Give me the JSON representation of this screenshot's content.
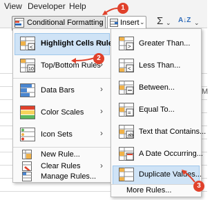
{
  "ribbon": {
    "tabs": [
      "View",
      "Developer",
      "Help"
    ],
    "conditional_formatting_label": "Conditional Formatting",
    "insert_label": "Insert",
    "sum_symbol": "Σ",
    "sort_symbol": "A↓Z"
  },
  "sheet": {
    "col_label": "M"
  },
  "menu": {
    "items": [
      {
        "label": "Highlight Cells Rules",
        "hotkey_index": 0
      },
      {
        "label": "Top/Bottom Rules"
      },
      {
        "label": "Data Bars"
      },
      {
        "label": "Color Scales"
      },
      {
        "label": "Icon Sets"
      },
      {
        "label": "New Rule..."
      },
      {
        "label": "Clear Rules"
      },
      {
        "label": "Manage Rules..."
      }
    ]
  },
  "submenu": {
    "items": [
      {
        "label": "Greater Than..."
      },
      {
        "label": "Less Than..."
      },
      {
        "label": "Between..."
      },
      {
        "label": "Equal To..."
      },
      {
        "label": "Text that Contains..."
      },
      {
        "label": "A Date Occurring..."
      },
      {
        "label": "Duplicate Values..."
      },
      {
        "label": "More Rules..."
      }
    ]
  },
  "badges": [
    "1",
    "2",
    "3"
  ],
  "colors": {
    "badge": "#e0412b",
    "hover": "#cfe3f6",
    "accent": "#2e6bb8"
  }
}
